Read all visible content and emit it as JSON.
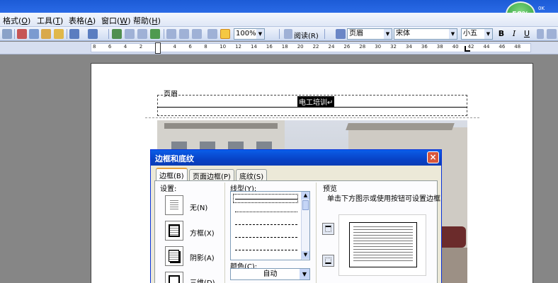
{
  "menu": {
    "items": [
      {
        "label": "格式(",
        "key": "O",
        "end": ")"
      },
      {
        "label": "工具(",
        "key": "T",
        "end": ")"
      },
      {
        "label": "表格(",
        "key": "A",
        "end": ")"
      },
      {
        "label": "窗口(",
        "key": "W",
        "end": ")"
      },
      {
        "label": "帮助(",
        "key": "H",
        "end": ")"
      }
    ]
  },
  "toolbar": {
    "zoom": "100%",
    "read_label": "阅读(R)",
    "style_value": "页眉",
    "font_value": "宋体",
    "size_value": "小五",
    "bold": "B",
    "italic": "I",
    "underline": "U"
  },
  "widget": {
    "percent": "58%",
    "line1": "0K",
    "line2": "0K"
  },
  "ruler": {
    "ticks": [
      "8",
      "6",
      "4",
      "2",
      "2",
      "4",
      "6",
      "8",
      "10",
      "12",
      "14",
      "16",
      "18",
      "20",
      "22",
      "24",
      "26",
      "28",
      "30",
      "32",
      "34",
      "36",
      "38",
      "40",
      "42",
      "44",
      "46",
      "48"
    ]
  },
  "document": {
    "header_label": "页眉",
    "header_text": "电工培训↵"
  },
  "dialog": {
    "title": "边框和底纹",
    "close": "×",
    "tabs": [
      "边框(B)",
      "页面边框(P)",
      "底纹(S)"
    ],
    "settings_label": "设置:",
    "settings": [
      "无(N)",
      "方框(X)",
      "阴影(A)",
      "三维(D)"
    ],
    "line_style_label": "线型(Y):",
    "color_label": "颜色(C):",
    "color_value": "自动",
    "preview_label": "预览",
    "preview_hint": "单击下方图示或使用按钮可设置边框"
  }
}
